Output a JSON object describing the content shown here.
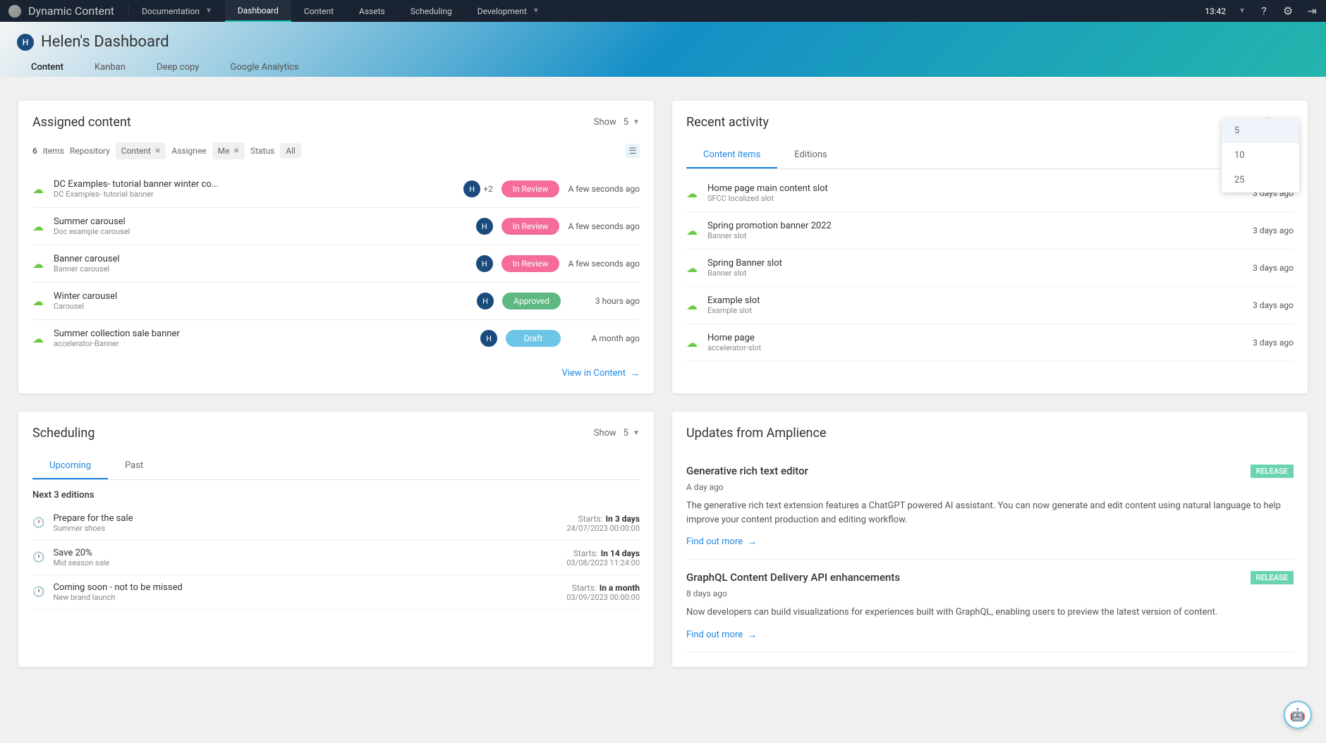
{
  "nav": {
    "app_name": "Dynamic Content",
    "items": [
      "Documentation",
      "Dashboard",
      "Content",
      "Assets",
      "Scheduling",
      "Development"
    ],
    "active_index": 1,
    "time": "13:42"
  },
  "hero": {
    "avatar_letter": "H",
    "title": "Helen's Dashboard",
    "tabs": [
      "Content",
      "Kanban",
      "Deep copy",
      "Google Analytics"
    ],
    "active_tab": 0
  },
  "assigned": {
    "title": "Assigned content",
    "show_label": "Show",
    "show_value": "5",
    "filter": {
      "count": "6",
      "items_label": "items",
      "repo_label": "Repository",
      "repo_chip": "Content",
      "assignee_label": "Assignee",
      "assignee_chip": "Me",
      "status_label": "Status",
      "status_chip": "All"
    },
    "rows": [
      {
        "name": "DC Examples- tutorial banner winter co...",
        "sub": "DC Examples- tutorial banner",
        "avatar": "H",
        "extra": "+2",
        "status": "In Review",
        "status_class": "status-review",
        "time": "A few seconds ago"
      },
      {
        "name": "Summer carousel",
        "sub": "Doc example carousel",
        "avatar": "H",
        "extra": "",
        "status": "In Review",
        "status_class": "status-review",
        "time": "A few seconds ago"
      },
      {
        "name": "Banner carousel",
        "sub": "Banner carousel",
        "avatar": "H",
        "extra": "",
        "status": "In Review",
        "status_class": "status-review",
        "time": "A few seconds ago"
      },
      {
        "name": "Winter carousel",
        "sub": "Carousel",
        "avatar": "H",
        "extra": "",
        "status": "Approved",
        "status_class": "status-approved",
        "time": "3 hours ago"
      },
      {
        "name": "Summer collection sale banner",
        "sub": "accelerator-Banner",
        "avatar": "H",
        "extra": "",
        "status": "Draft",
        "status_class": "status-draft",
        "time": "A month ago"
      }
    ],
    "footer_link": "View in Content"
  },
  "recent": {
    "title": "Recent activity",
    "show_label": "Show",
    "tabs": [
      "Content items",
      "Editions"
    ],
    "active_tab": 0,
    "dropdown_options": [
      "5",
      "10",
      "25"
    ],
    "dropdown_selected": 0,
    "rows": [
      {
        "name": "Home page main content slot",
        "sub": "SFCC localized slot",
        "time": "3 days ago"
      },
      {
        "name": "Spring promotion banner 2022",
        "sub": "Banner slot",
        "time": "3 days ago"
      },
      {
        "name": "Spring Banner slot",
        "sub": "Banner slot",
        "time": "3 days ago"
      },
      {
        "name": "Example slot",
        "sub": "Example slot",
        "time": "3 days ago"
      },
      {
        "name": "Home page",
        "sub": "accelerator-slot",
        "time": "3 days ago"
      }
    ]
  },
  "scheduling": {
    "title": "Scheduling",
    "show_label": "Show",
    "show_value": "5",
    "tabs": [
      "Upcoming",
      "Past"
    ],
    "active_tab": 0,
    "section_label": "Next 3 editions",
    "starts_label": "Starts:",
    "rows": [
      {
        "name": "Prepare for the sale",
        "sub": "Summer shoes",
        "time": "In 3 days",
        "datetime": "24/07/2023 00:00:00"
      },
      {
        "name": "Save 20%",
        "sub": "Mid season sale",
        "time": "In 14 days",
        "datetime": "03/08/2023 11:24:00"
      },
      {
        "name": "Coming soon - not to be missed",
        "sub": "New brand launch",
        "time": "In a month",
        "datetime": "03/09/2023 00:00:00"
      }
    ]
  },
  "updates": {
    "title": "Updates from Amplience",
    "find_out_more": "Find out more",
    "release_badge": "RELEASE",
    "items": [
      {
        "title": "Generative rich text editor",
        "time": "A day ago",
        "text": "The generative rich text extension features a ChatGPT powered AI assistant. You can now generate and edit content using natural language to help improve your content production and editing workflow."
      },
      {
        "title": "GraphQL Content Delivery API enhancements",
        "time": "8 days ago",
        "text": "Now developers can build visualizations for experiences built with GraphQL, enabling users to preview the latest version of content."
      }
    ]
  }
}
